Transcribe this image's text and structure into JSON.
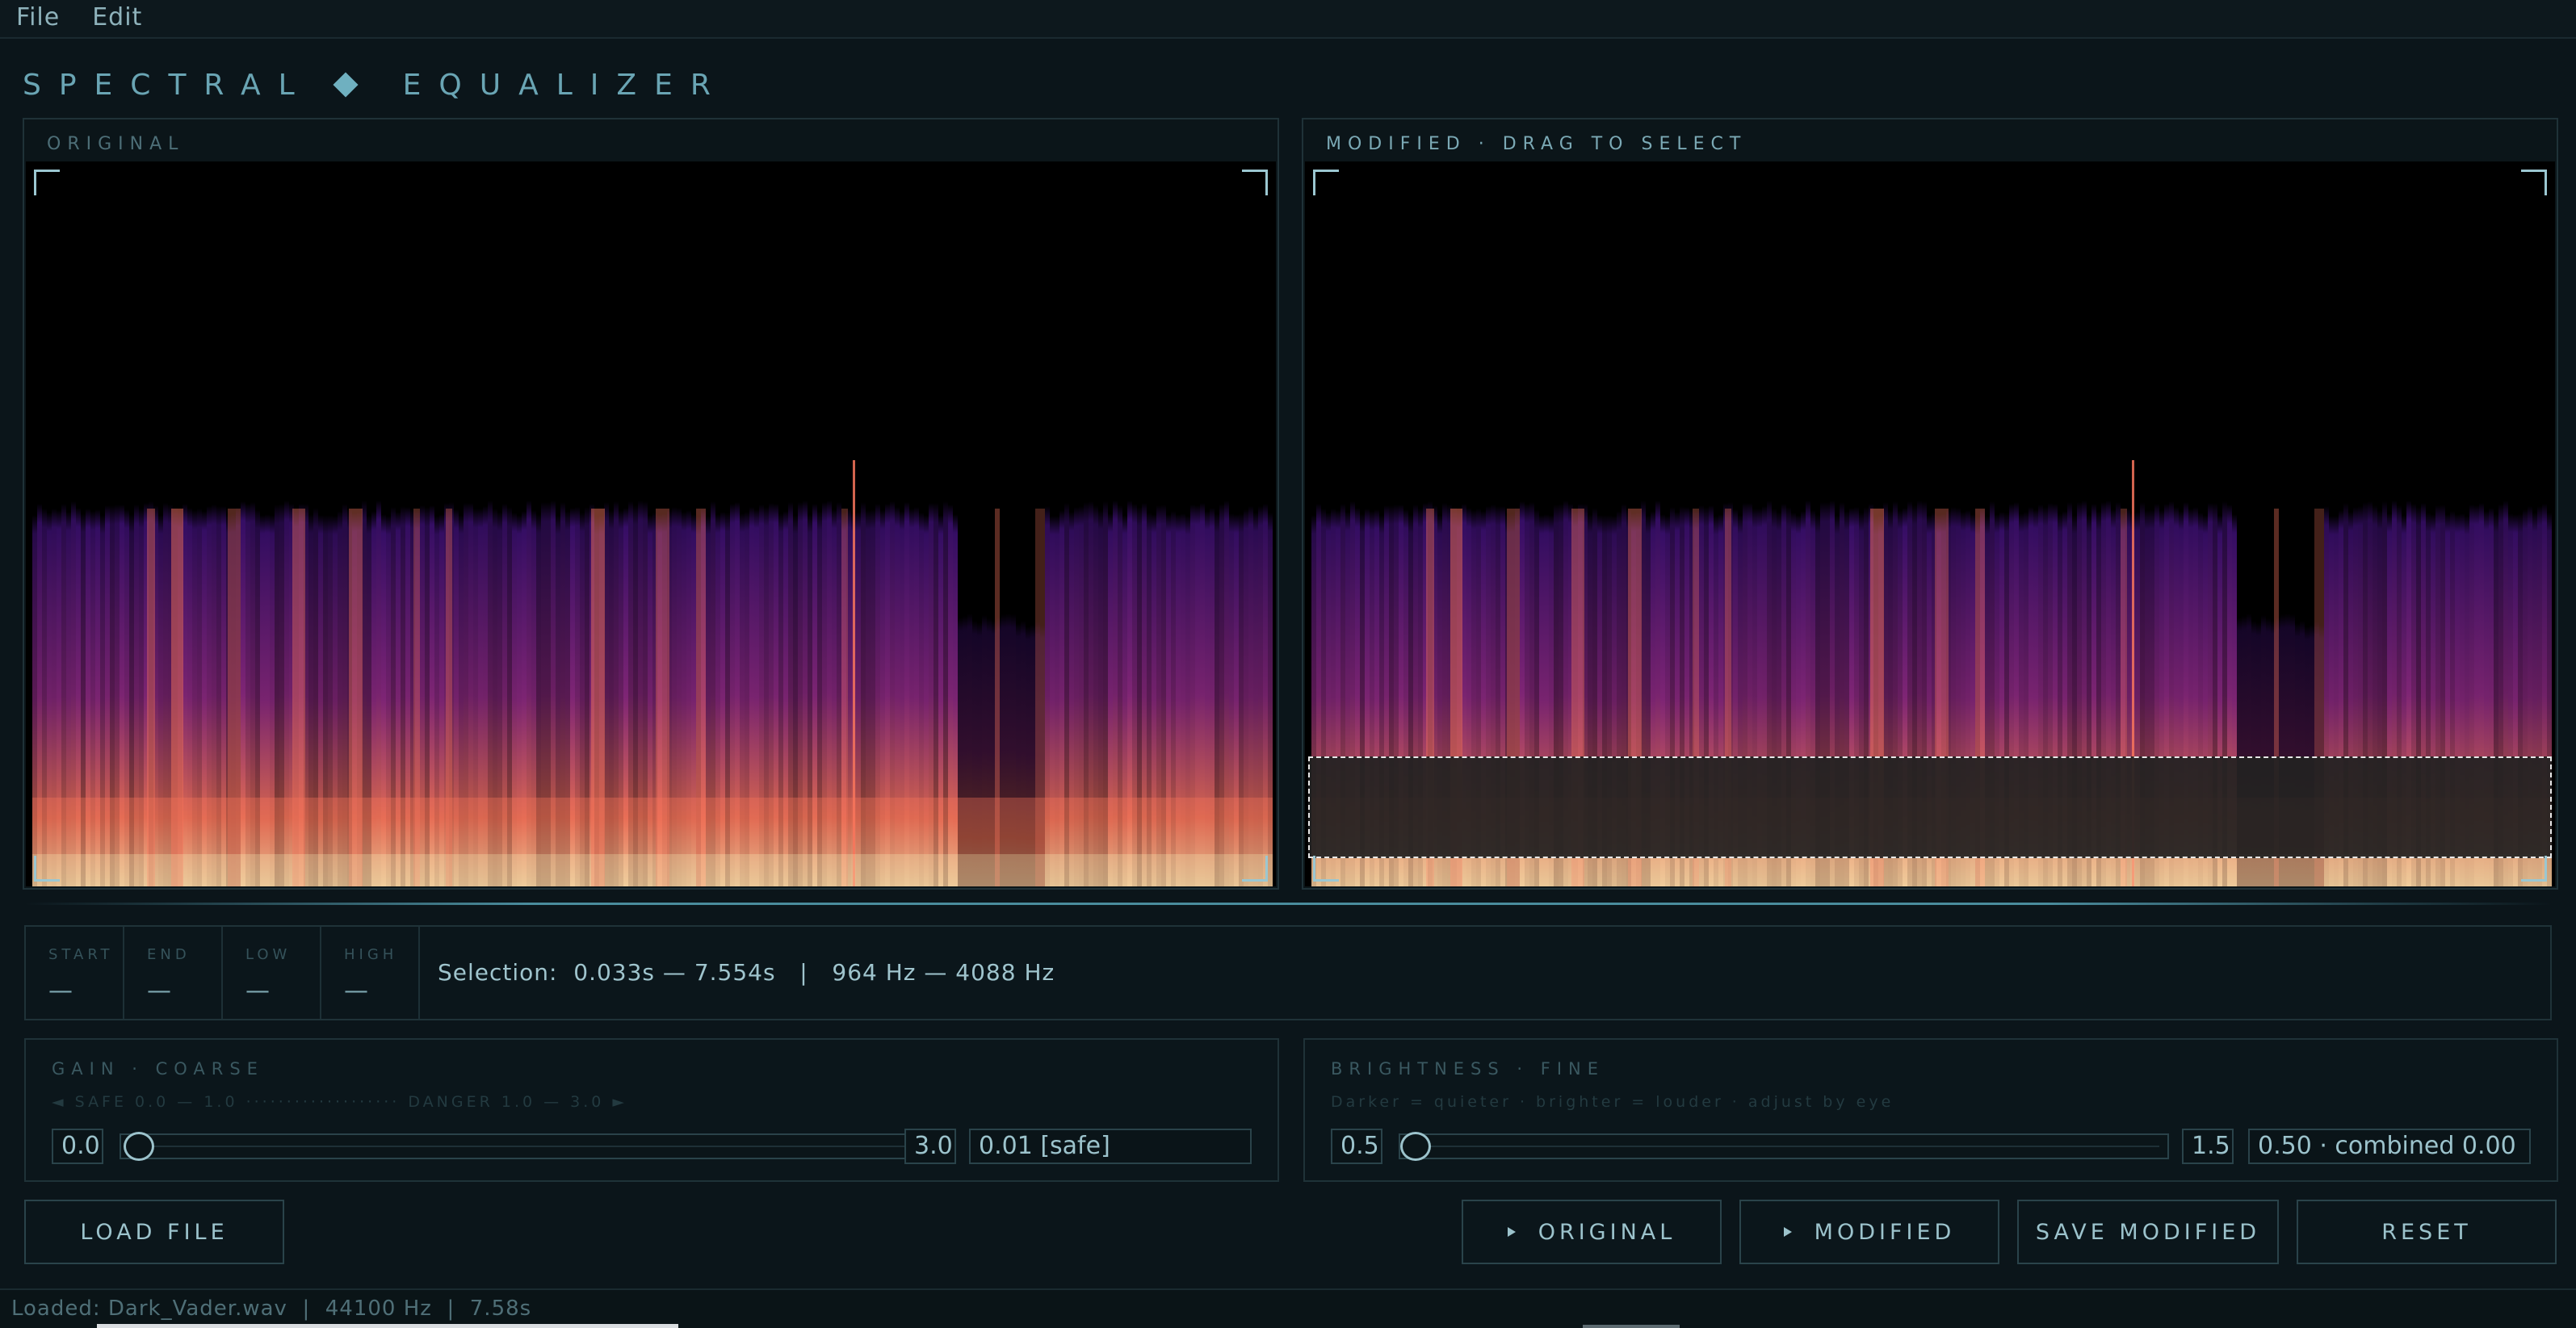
{
  "menu": {
    "file": "File",
    "edit": "Edit"
  },
  "app": {
    "title_left": "SPECTRAL",
    "title_right": "EQUALIZER"
  },
  "original_panel": {
    "label": "ORIGINAL"
  },
  "modified_panel": {
    "label": "MODIFIED  ·  DRAG TO SELECT"
  },
  "spectrogram_colors": {
    "dark": "#000000",
    "purple": "#3b0f70",
    "magenta": "#8c2981",
    "orange": "#f8765c",
    "yellow": "#fcfdbf"
  },
  "info": {
    "start_label": "START",
    "start_value": "—",
    "end_label": "END",
    "end_value": "—",
    "low_label": "LOW",
    "low_value": "—",
    "high_label": "HIGH",
    "high_value": "—",
    "selection": "Selection:  0.033s — 7.554s   |   964 Hz — 4088 Hz"
  },
  "gain": {
    "title": "GAIN  ·  COARSE",
    "hint": "◄  SAFE  0.0 — 1.0  ···················  DANGER  1.0 — 3.0  ►",
    "min": "0.0",
    "max": "3.0",
    "readout": "0.01  [safe]",
    "level": 0.003
  },
  "brightness": {
    "title": "BRIGHTNESS  ·  FINE",
    "hint": "Darker = quieter  ·  brighter = louder  ·  adjust by eye",
    "min": "0.5",
    "max": "1.5",
    "readout": "0.50  · combined 0.00",
    "level": 0.0
  },
  "buttons": {
    "load": "LOAD FILE",
    "play_original": "ORIGINAL",
    "play_modified": "MODIFIED",
    "save": "SAVE MODIFIED",
    "reset": "RESET"
  },
  "status": {
    "text": "Loaded: Dark_Vader.wav  |  44100 Hz  |  7.58s"
  }
}
